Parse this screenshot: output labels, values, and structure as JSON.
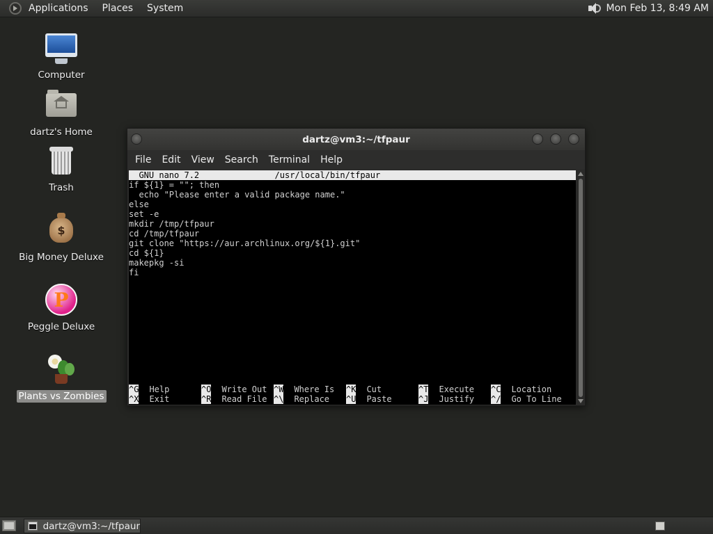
{
  "top_panel": {
    "menus": [
      "Applications",
      "Places",
      "System"
    ],
    "clock": "Mon Feb 13,  8:49 AM",
    "volume_icon": "speaker-volume-icon"
  },
  "desktop_icons": [
    {
      "label": "Computer",
      "icon": "computer-icon"
    },
    {
      "label": "dartz's Home",
      "icon": "home-folder-icon"
    },
    {
      "label": "Trash",
      "icon": "trash-icon"
    },
    {
      "label": "Big Money Deluxe",
      "icon": "money-bag-icon"
    },
    {
      "label": "Peggle Deluxe",
      "icon": "peggle-icon"
    },
    {
      "label": "Plants vs Zombies",
      "icon": "plants-vs-zombies-icon",
      "selected": true
    }
  ],
  "terminal": {
    "title": "dartz@vm3:~/tfpaur",
    "menu": [
      "File",
      "Edit",
      "View",
      "Search",
      "Terminal",
      "Help"
    ],
    "nano_header": "  GNU nano 7.2               /usr/local/bin/tfpaur",
    "lines": [
      "if ${1} = \"\"; then",
      "  echo \"Please enter a valid package name.\"",
      "else",
      "set -e",
      "mkdir /tmp/tfpaur",
      "cd /tmp/tfpaur",
      "git clone \"https://aur.archlinux.org/${1}.git\"",
      "cd ${1}",
      "makepkg -si",
      "fi"
    ],
    "shortcuts_row1": [
      {
        "key": "^G",
        "label": "Help"
      },
      {
        "key": "^O",
        "label": "Write Out"
      },
      {
        "key": "^W",
        "label": "Where Is"
      },
      {
        "key": "^K",
        "label": "Cut"
      },
      {
        "key": "^T",
        "label": "Execute"
      },
      {
        "key": "^C",
        "label": "Location"
      }
    ],
    "shortcuts_row2": [
      {
        "key": "^X",
        "label": "Exit"
      },
      {
        "key": "^R",
        "label": "Read File"
      },
      {
        "key": "^\\",
        "label": "Replace"
      },
      {
        "key": "^U",
        "label": "Paste"
      },
      {
        "key": "^J",
        "label": "Justify"
      },
      {
        "key": "^/",
        "label": "Go To Line"
      }
    ]
  },
  "bottom_panel": {
    "task_label": "dartz@vm3:~/tfpaur"
  }
}
